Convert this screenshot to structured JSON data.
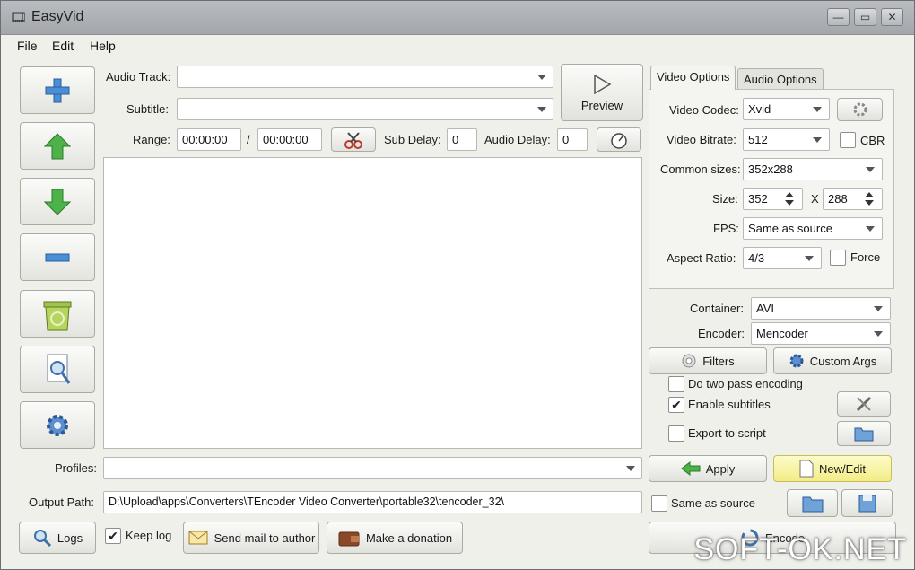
{
  "window": {
    "title": "EasyVid",
    "minimize": "—",
    "maximize": "▭",
    "close": "✕"
  },
  "menu": [
    "File",
    "Edit",
    "Help"
  ],
  "sidebar": [
    {
      "name": "add-icon"
    },
    {
      "name": "move-up-icon"
    },
    {
      "name": "move-down-icon"
    },
    {
      "name": "remove-icon"
    },
    {
      "name": "recycle-bin-icon"
    },
    {
      "name": "inspect-icon"
    },
    {
      "name": "settings-gear-icon"
    }
  ],
  "top": {
    "audio_track_label": "Audio Track:",
    "audio_track_value": "",
    "subtitle_label": "Subtitle:",
    "subtitle_value": "",
    "preview_label": "Preview",
    "range_label": "Range:",
    "range_start": "00:00:00",
    "range_sep": "/",
    "range_end": "00:00:00",
    "sub_delay_label": "Sub Delay:",
    "sub_delay_value": "0",
    "audio_delay_label": "Audio Delay:",
    "audio_delay_value": "0"
  },
  "tabs": {
    "video": "Video Options",
    "audio": "Audio Options"
  },
  "video_options": {
    "codec_label": "Video Codec:",
    "codec_value": "Xvid",
    "bitrate_label": "Video Bitrate:",
    "bitrate_value": "512",
    "cbr_label": "CBR",
    "common_sizes_label": "Common sizes:",
    "common_sizes_value": "352x288",
    "size_label": "Size:",
    "size_w": "352",
    "size_x": "X",
    "size_h": "288",
    "fps_label": "FPS:",
    "fps_value": "Same as source",
    "aspect_label": "Aspect Ratio:",
    "aspect_value": "4/3",
    "force_label": "Force"
  },
  "container": {
    "label": "Container:",
    "value": "AVI"
  },
  "encoder": {
    "label": "Encoder:",
    "value": "Mencoder"
  },
  "buttons": {
    "filters": "Filters",
    "custom_args": "Custom Args",
    "apply": "Apply",
    "new_edit": "New/Edit",
    "logs": "Logs",
    "send_mail": "Send mail to author",
    "donation": "Make a donation",
    "encode": "Encode"
  },
  "checkboxes": {
    "two_pass": {
      "label": "Do two pass encoding",
      "checked": false
    },
    "enable_subtitles": {
      "label": "Enable subtitles",
      "checked": true
    },
    "export_script": {
      "label": "Export to script",
      "checked": false
    },
    "same_as_source": {
      "label": "Same as source",
      "checked": false
    },
    "keep_log": {
      "label": "Keep log",
      "checked": true
    }
  },
  "profiles": {
    "label": "Profiles:",
    "value": ""
  },
  "output": {
    "label": "Output Path:",
    "value": "D:\\Upload\\apps\\Converters\\TEncoder Video Converter\\portable32\\tencoder_32\\"
  },
  "watermark": "SOFT-OK.NET"
}
